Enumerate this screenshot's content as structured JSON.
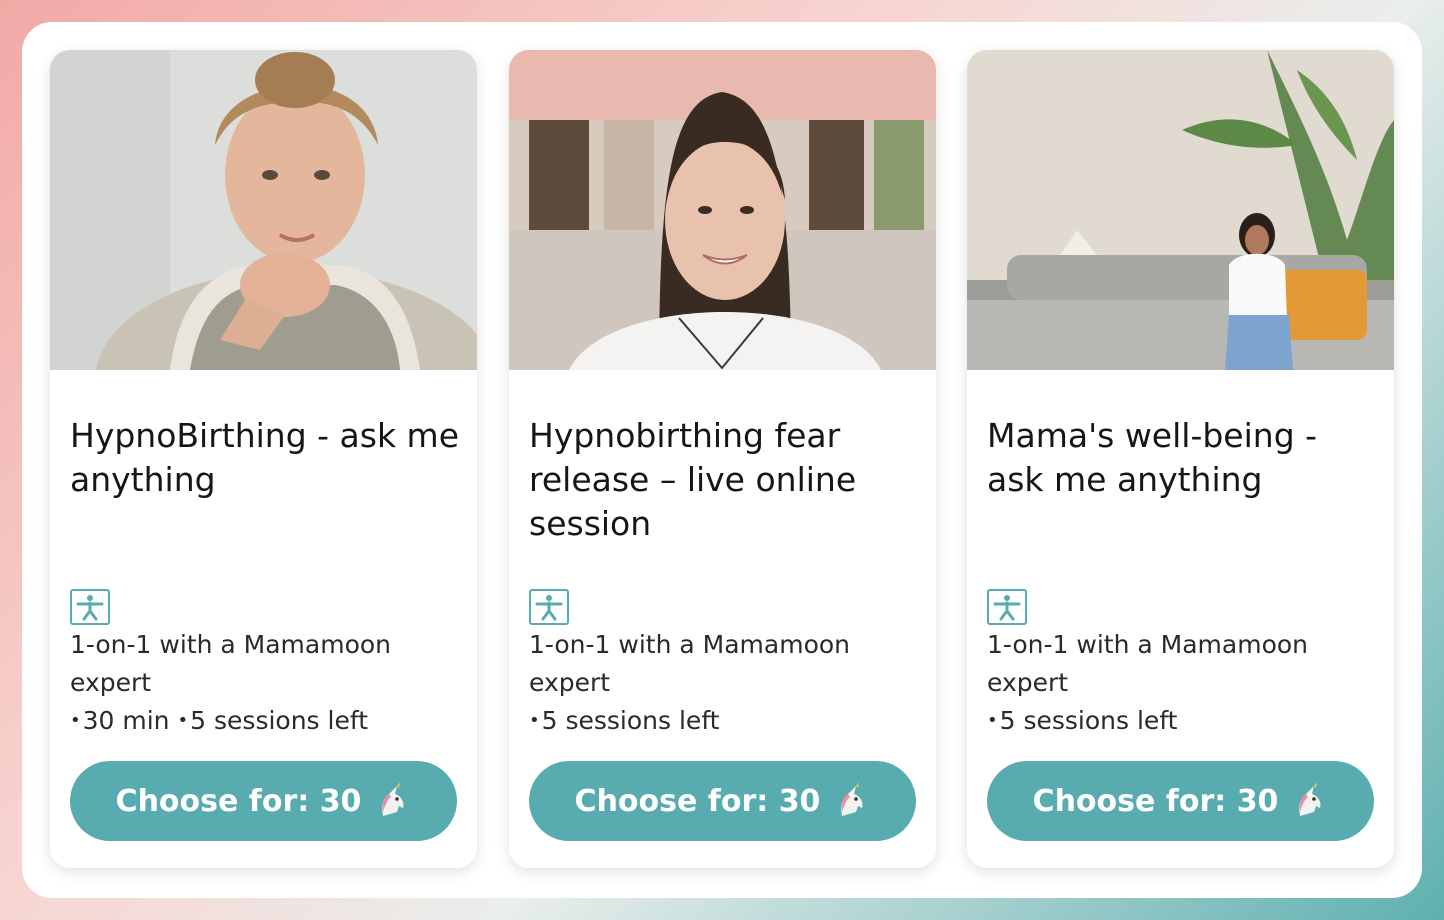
{
  "cards": [
    {
      "title": "HypnoBirthing - ask me anything",
      "icon": "yoga-person-icon",
      "description": "1-on-1 with a Mamamoon expert",
      "meta": [
        "30 min",
        "5 sessions left"
      ],
      "cta_label": "Choose for: 30",
      "cta_icon": "unicorn-icon"
    },
    {
      "title": "Hypnobirthing fear release – live online session",
      "icon": "yoga-person-icon",
      "description": "1-on-1 with a Mamamoon expert",
      "meta": [
        "5 sessions left"
      ],
      "cta_label": "Choose for: 30",
      "cta_icon": "unicorn-icon"
    },
    {
      "title": "Mama's well-being - ask me anything",
      "icon": "yoga-person-icon",
      "description": "1-on-1 with a Mamamoon expert",
      "meta": [
        "5 sessions left"
      ],
      "cta_label": "Choose for: 30",
      "cta_icon": "unicorn-icon"
    }
  ],
  "colors": {
    "accent": "#58abae",
    "text": "#161616",
    "card_bg": "#ffffff"
  }
}
